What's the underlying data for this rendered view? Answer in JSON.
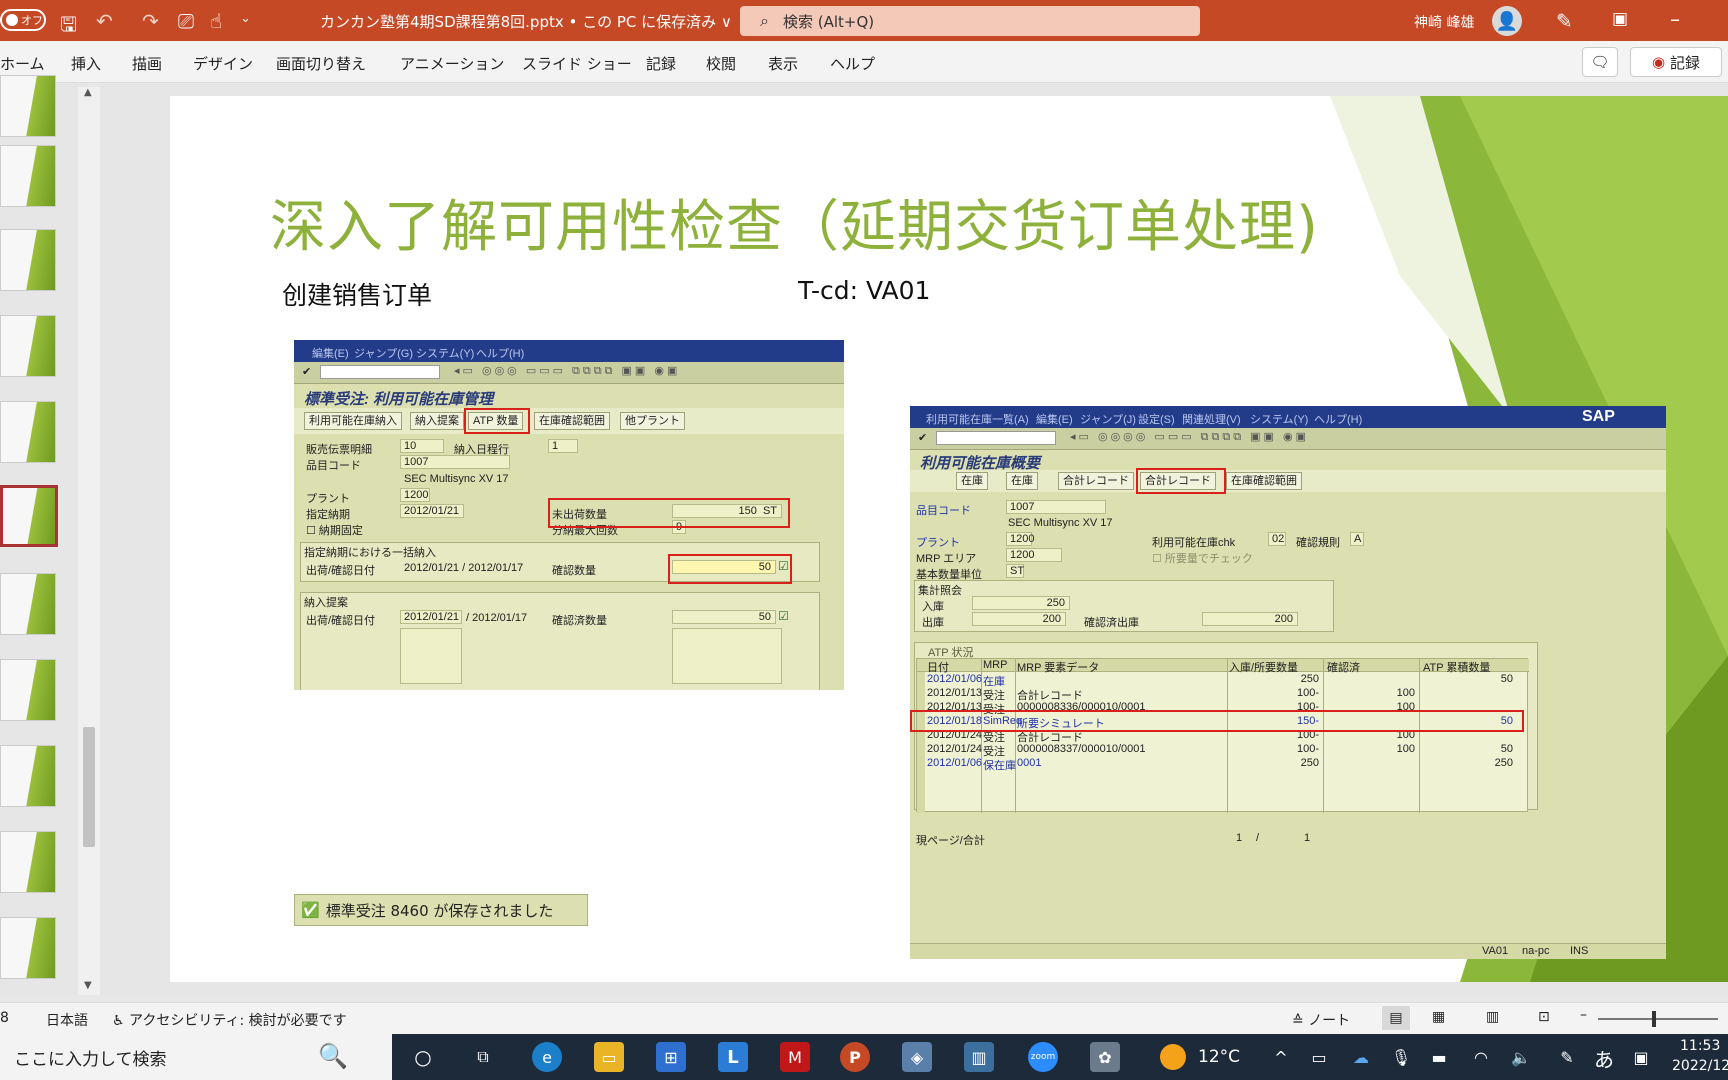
{
  "app": {
    "autosave_label": "オフ",
    "doc_title": "カンカン塾第4期SD課程第8回.pptx • この PC に保存済み ∨",
    "search_placeholder": "検索 (Alt+Q)",
    "user_name": "神崎 峰雄",
    "accent_color": "#c64926"
  },
  "ribbon": {
    "tabs": [
      "ホーム",
      "挿入",
      "描画",
      "デザイン",
      "画面切り替え",
      "アニメーション",
      "スライド ショー",
      "記録",
      "校閲",
      "表示",
      "ヘルプ"
    ],
    "record_label": "記録"
  },
  "slide": {
    "title": "深入了解可用性检查（延期交货订单处理)",
    "sub_left": "创建销售订单",
    "sub_right": "T-cd: VA01",
    "title_color": "#8db13a"
  },
  "sap_left": {
    "menu": [
      "編集(E)",
      "ジャンプ(G)",
      "システム(Y)",
      "ヘルプ(H)"
    ],
    "title": "標準受注: 利用可能在庫管理",
    "buttons": [
      "利用可能在庫納入",
      "納入提案",
      "ATP 数量",
      "在庫確認範囲",
      "他プラント"
    ],
    "labels": {
      "doc_item": "販売伝票明細",
      "doc_item_val": "10",
      "delivery_item": "納入日程行",
      "delivery_item_val": "1",
      "material": "品目コード",
      "material_val": "1007",
      "material_desc": "SEC Multisync XV 17",
      "plant": "プラント",
      "plant_val": "1200",
      "req_date": "指定納期",
      "req_date_val": "2012/01/21",
      "fixed": "納期固定",
      "open_qty": "未出荷数量",
      "open_qty_val": "150",
      "open_qty_unit": "ST",
      "max_partial": "分納最大回数",
      "max_partial_val": "9",
      "group1": "指定納期における一括納入",
      "ship_date": "出荷/確認日付",
      "date_pair1": "2012/01/21  /  2012/01/17",
      "confirmed_qty": "確認数量",
      "confirmed_qty_val": "50",
      "group2": "納入提案",
      "ship_date2": "出荷/確認日付",
      "date2a": "2012/01/21",
      "date2b": "/  2012/01/17",
      "confirmed2": "確認済数量",
      "confirmed2_val": "50"
    },
    "saved_msg": "標準受注 8460 が保存されました"
  },
  "sap_right": {
    "menu": [
      "利用可能在庫一覧(A)",
      "編集(E)",
      "ジャンプ(J)",
      "設定(S)",
      "関連処理(V)",
      "システム(Y)",
      "ヘルプ(H)"
    ],
    "logo": "SAP",
    "title": "利用可能在庫概要",
    "buttons": [
      "在庫",
      "在庫",
      "合計レコード",
      "合計レコード",
      "在庫確認範囲"
    ],
    "labels": {
      "material": "品目コード",
      "material_val": "1007",
      "material_desc": "SEC Multisync XV 17",
      "plant": "プラント",
      "plant_val": "1200",
      "atp_chk": "利用可能在庫chk",
      "atp_chk_val": "02",
      "conf_rule": "確認規則",
      "conf_rule_val": "A",
      "mrp_area": "MRP エリア",
      "mrp_area_val": "1200",
      "req_check": "所要量でチェック",
      "base_unit": "基本数量単位",
      "base_unit_val": "ST",
      "summary": "集計照会",
      "receipt": "入庫",
      "receipt_val": "250",
      "issue": "出庫",
      "issue_val": "200",
      "confirmed_issue": "確認済出庫",
      "confirmed_issue_val": "200",
      "atp_status": "ATP 状況"
    },
    "table_headers": [
      "日付",
      "MRP",
      "MRP 要素データ",
      "入庫/所要数量",
      "確認済",
      "ATP 累積数量"
    ],
    "rows": [
      [
        "2012/01/06",
        "在庫",
        "",
        "250",
        "",
        "50"
      ],
      [
        "2012/01/13",
        "受注",
        "合計レコード",
        "100-",
        "100",
        ""
      ],
      [
        "2012/01/13",
        "受注",
        "0000008336/000010/0001",
        "100-",
        "100",
        ""
      ],
      [
        "2012/01/18",
        "SimReq",
        "所要シミュレート",
        "150-",
        "",
        "50"
      ],
      [
        "2012/01/24",
        "受注",
        "合計レコード",
        "100-",
        "100",
        ""
      ],
      [
        "2012/01/24",
        "受注",
        "0000008337/000010/0001",
        "100-",
        "100",
        "50"
      ],
      [
        "2012/01/06",
        "保在庫",
        "0001",
        "250",
        "",
        "250"
      ]
    ],
    "page_label": "現ページ/合計",
    "page_cur": "1",
    "page_sep": "/",
    "page_total": "1",
    "status_sys": "VA01",
    "status_host": "na-pc",
    "status_mode": "INS"
  },
  "statusbar": {
    "slide_num": "8",
    "language": "日本語",
    "accessibility": "アクセシビリティ: 検討が必要です",
    "notes": "ノート"
  },
  "taskbar": {
    "search": "ここに入力して検索",
    "weather": "12°C",
    "ime": "あ",
    "time": "11:53",
    "date": "2022/12"
  }
}
